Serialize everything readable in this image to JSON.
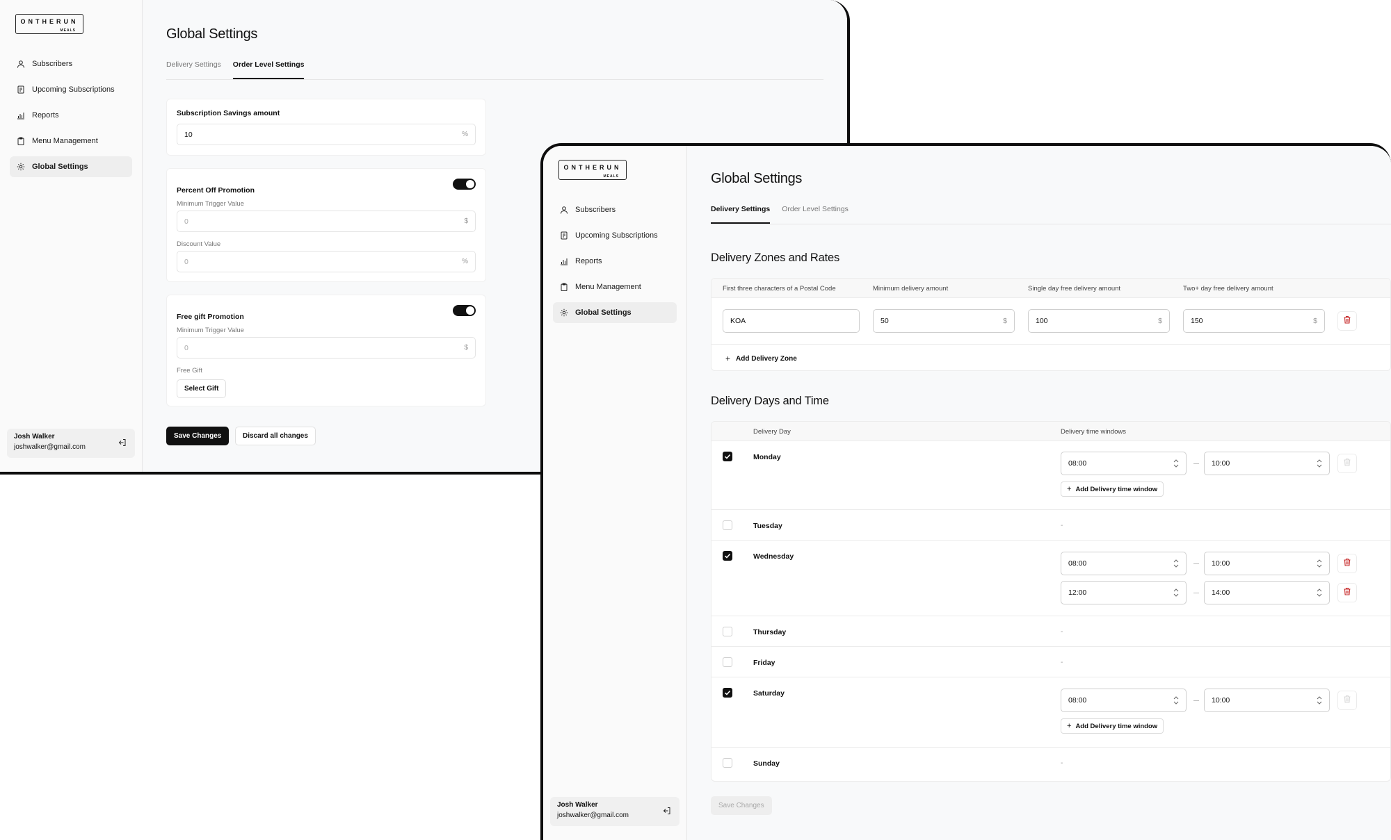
{
  "brand": {
    "logo_text": "ONTHERUN",
    "logo_sub": "MEALS"
  },
  "nav": [
    {
      "label": "Subscribers",
      "icon": "user-icon"
    },
    {
      "label": "Upcoming Subscriptions",
      "icon": "receipt-icon"
    },
    {
      "label": "Reports",
      "icon": "bar-chart-icon"
    },
    {
      "label": "Menu Management",
      "icon": "clipboard-icon"
    },
    {
      "label": "Global Settings",
      "icon": "gear-icon"
    }
  ],
  "user": {
    "name": "Josh Walker",
    "email": "joshwalker@gmail.com"
  },
  "page_title": "Global Settings",
  "tabs": {
    "delivery": "Delivery Settings",
    "order": "Order Level Settings"
  },
  "order_settings": {
    "savings": {
      "label": "Subscription Savings amount",
      "value": "10",
      "unit": "%"
    },
    "percent_off": {
      "label": "Percent Off Promotion",
      "enabled": true,
      "min_label": "Minimum Trigger Value",
      "min_value": "0",
      "min_unit": "$",
      "discount_label": "Discount Value",
      "discount_value": "0",
      "discount_unit": "%"
    },
    "free_gift": {
      "label": "Free gift Promotion",
      "enabled": true,
      "min_label": "Minimum Trigger Value",
      "min_value": "0",
      "min_unit": "$",
      "gift_label": "Free Gift",
      "select_button": "Select Gift"
    },
    "save_button": "Save Changes",
    "discard_button": "Discard all changes"
  },
  "delivery_settings": {
    "zones_title": "Delivery Zones and Rates",
    "zone_columns": [
      "First three characters of a Postal Code",
      "Minimum delivery amount",
      "Single day free delivery amount",
      "Two+ day free delivery amount"
    ],
    "zone_row": {
      "postal": "KOA",
      "minimum": "50",
      "single_day": "100",
      "two_plus": "150",
      "unit": "$"
    },
    "add_zone": "Add Delivery Zone",
    "days_title": "Delivery Days and Time",
    "day_columns": [
      "Delivery Day",
      "Delivery time windows"
    ],
    "days": [
      {
        "name": "Monday",
        "checked": true,
        "windows": [
          {
            "from": "08:00",
            "to": "10:00"
          }
        ],
        "add": "Add Delivery time window"
      },
      {
        "name": "Tuesday",
        "checked": false,
        "empty": "-"
      },
      {
        "name": "Wednesday",
        "checked": true,
        "windows": [
          {
            "from": "08:00",
            "to": "10:00"
          },
          {
            "from": "12:00",
            "to": "14:00"
          }
        ]
      },
      {
        "name": "Thursday",
        "checked": false,
        "empty": "-"
      },
      {
        "name": "Friday",
        "checked": false,
        "empty": "-"
      },
      {
        "name": "Saturday",
        "checked": true,
        "windows": [
          {
            "from": "08:00",
            "to": "10:00"
          }
        ],
        "add": "Add Delivery time window"
      },
      {
        "name": "Sunday",
        "checked": false,
        "empty": "-"
      }
    ],
    "save_button": "Save Changes"
  },
  "colors": {
    "accent": "#111111",
    "danger": "#c62828",
    "background": "#f8f9fa"
  }
}
